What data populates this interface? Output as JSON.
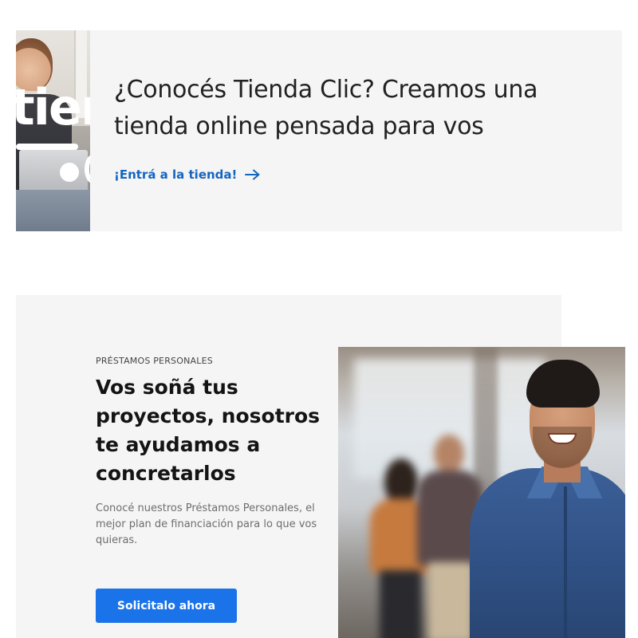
{
  "store_banner": {
    "logo_text": "tien",
    "title": "¿Conocés Tienda Clic? Creamos una tienda online pensada para vos",
    "link_label": "¡Entrá a la tienda!",
    "link_icon": "arrow-right-icon",
    "link_color": "#1565c0",
    "background_color": "#f5f5f5"
  },
  "loans_promo": {
    "eyebrow": "PRÉSTAMOS PERSONALES",
    "title": "Vos soñá tus proyectos, nosotros te ayudamos a concretarlos",
    "description": "Conocé nuestros Préstamos Personales, el mejor plan de financiación para lo que vos quieras.",
    "cta_label": "Solicitalo ahora",
    "cta_color": "#1a73e8",
    "background_color": "#f5f5f5"
  }
}
